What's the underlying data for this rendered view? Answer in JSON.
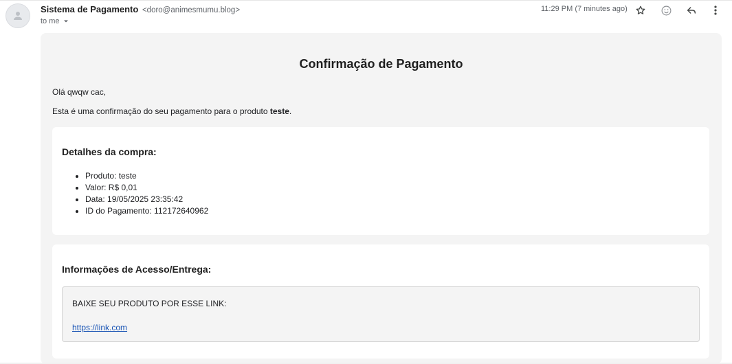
{
  "header": {
    "sender_name": "Sistema de Pagamento",
    "sender_email": "<doro@animesmumu.blog>",
    "to_label": "to me",
    "timestamp": "11:29 PM (7 minutes ago)",
    "icons": [
      "avatar-person-icon",
      "star-icon",
      "emoji-icon",
      "reply-icon",
      "more-options-icon"
    ]
  },
  "email": {
    "title": "Confirmação de Pagamento",
    "greeting": "Olá qwqw cac,",
    "intro_prefix": "Esta é uma confirmação do seu pagamento para o produto ",
    "intro_product": "teste",
    "intro_suffix": ".",
    "details": {
      "heading": "Detalhes da compra:",
      "items": [
        "Produto: teste",
        "Valor: R$ 0,01",
        "Data: 19/05/2025 23:35:42",
        "ID do Pagamento: 112172640962"
      ]
    },
    "access": {
      "heading": "Informações de Acesso/Entrega:",
      "text": "BAIXE SEU PRODUTO POR ESSE LINK:",
      "link": "https://link.com"
    }
  },
  "colors": {
    "email_background": "#f4f4f4",
    "card_background": "#ffffff",
    "link": "#1a55b5",
    "secondary_text": "#5f6368"
  }
}
